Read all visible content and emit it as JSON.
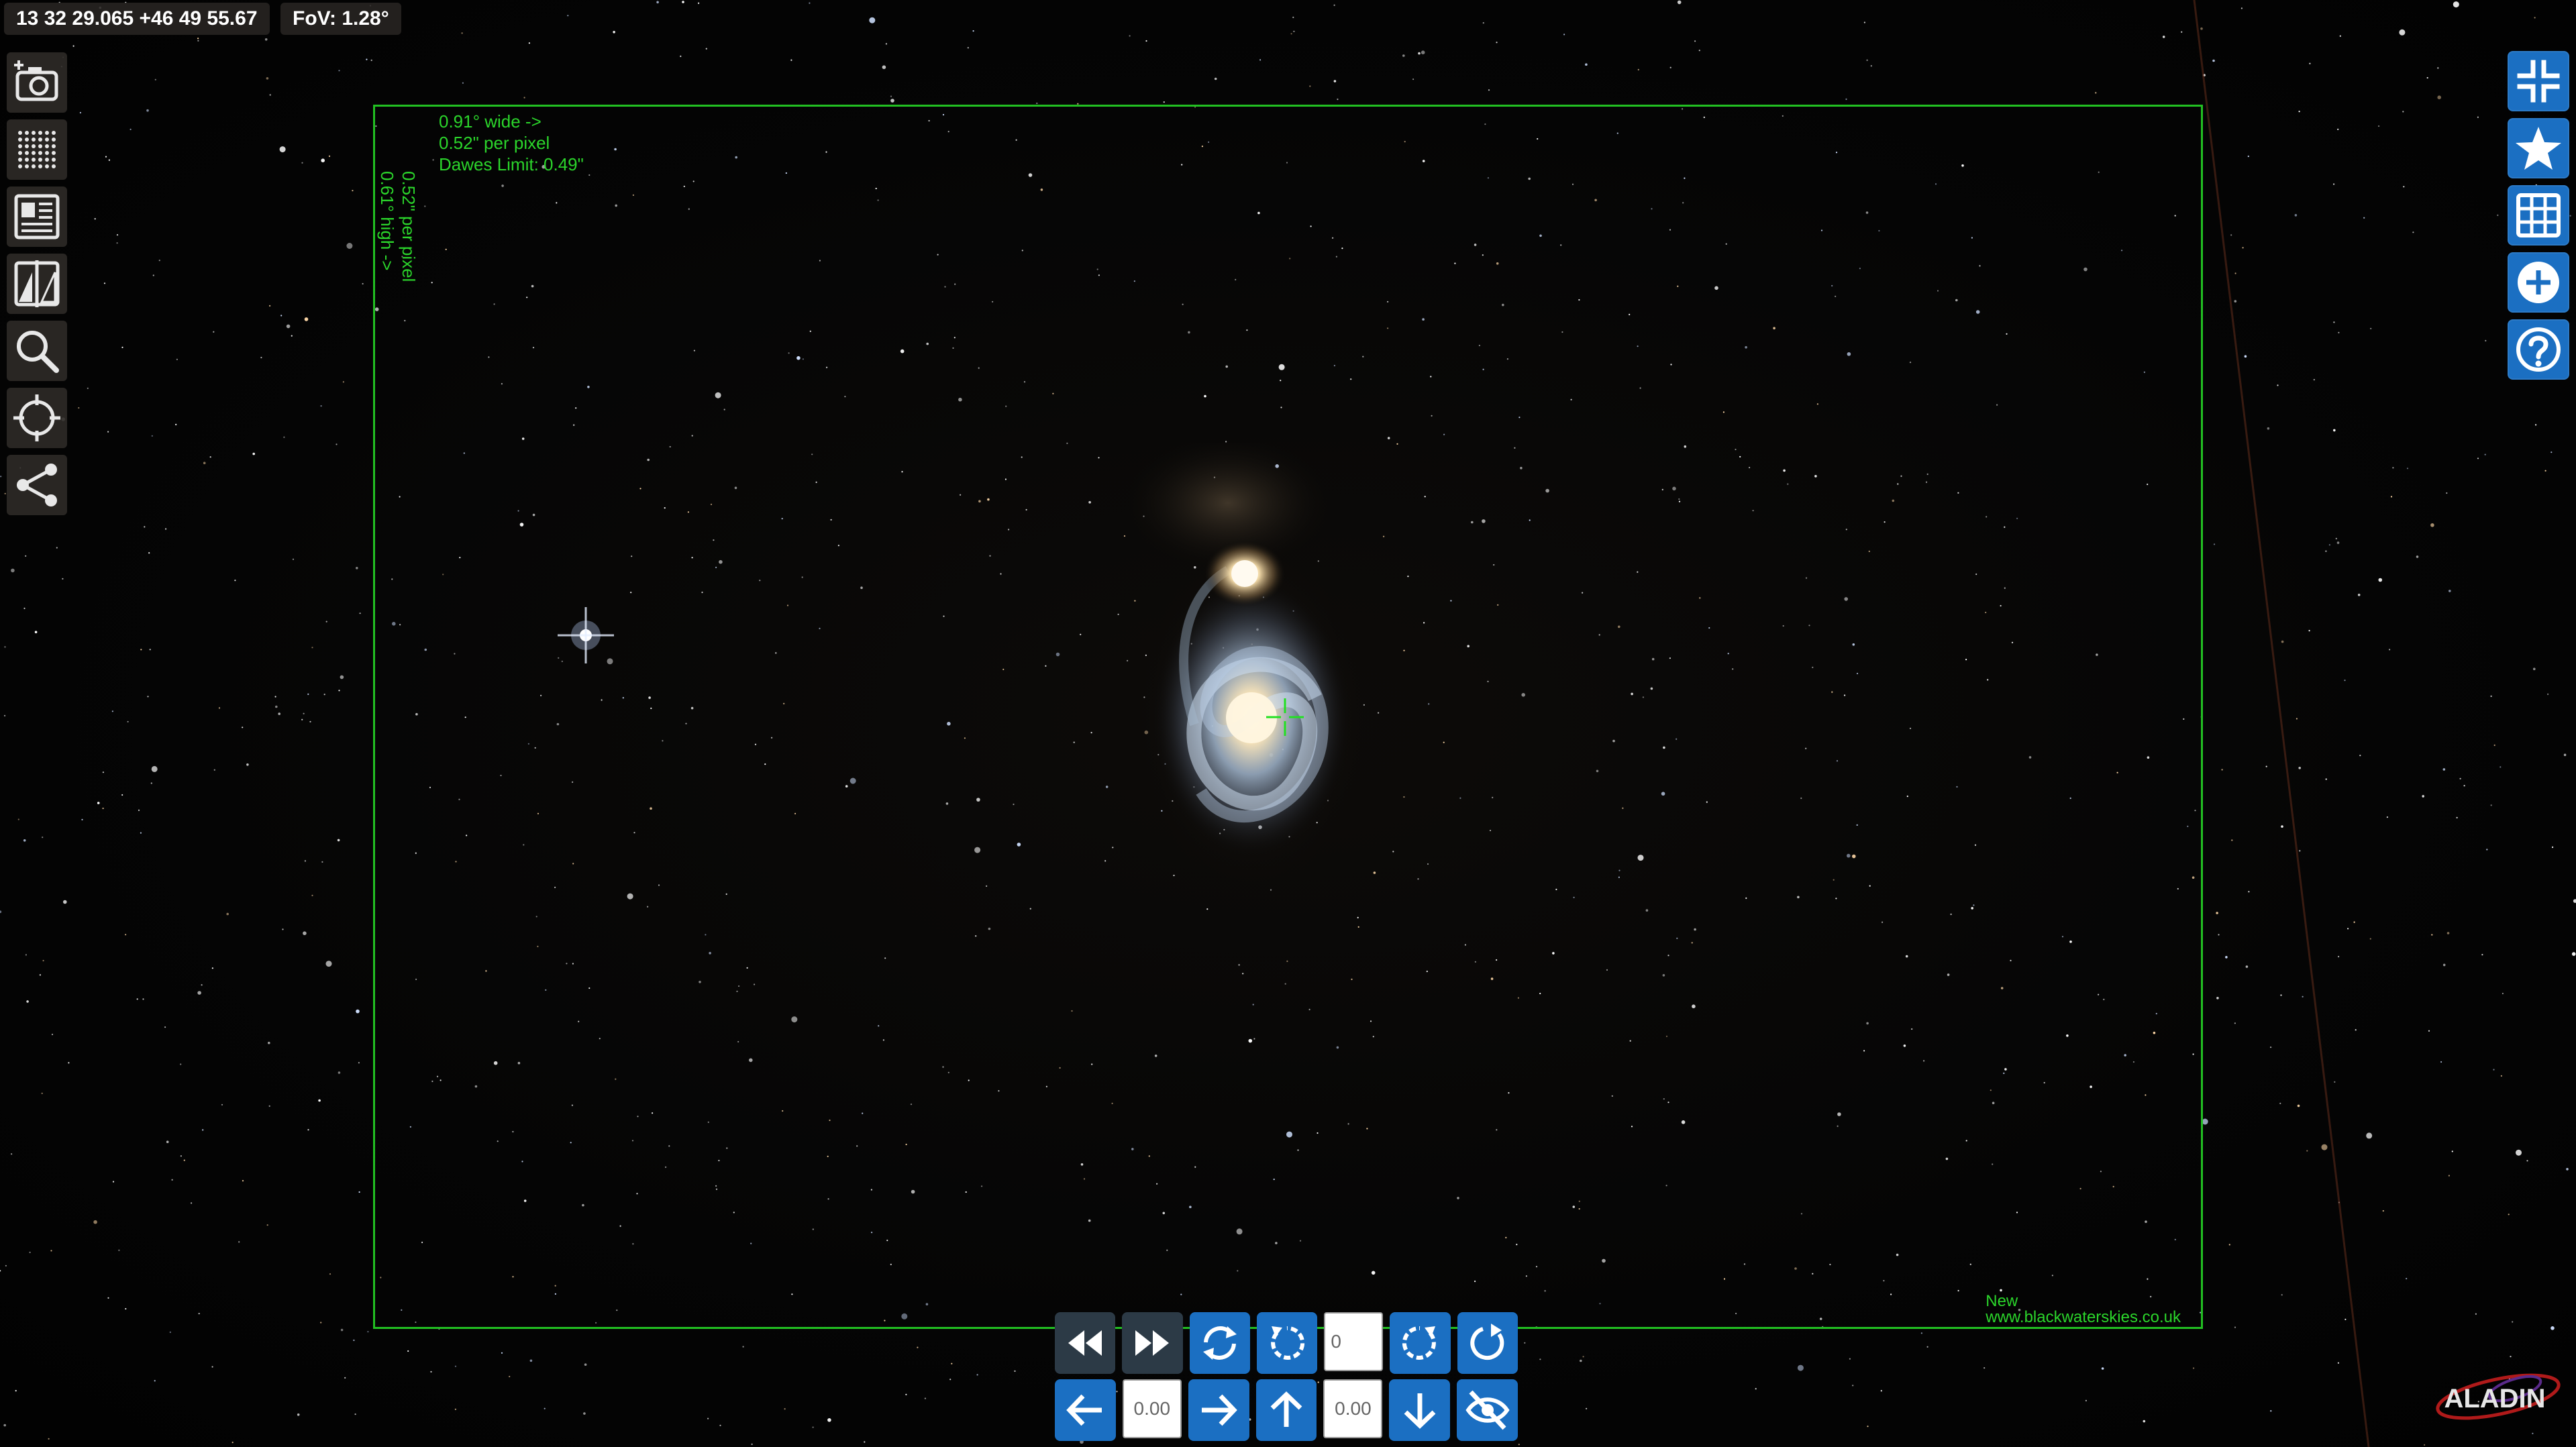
{
  "status": {
    "coordinates": "13 32 29.065 +46 49 55.67",
    "fov": "FoV: 1.28°"
  },
  "left_toolbar": [
    {
      "name": "snapshot-button",
      "icon": "camera-icon"
    },
    {
      "name": "layers-button",
      "icon": "dots-grid-icon"
    },
    {
      "name": "catalog-button",
      "icon": "panel-icon"
    },
    {
      "name": "compare-button",
      "icon": "split-view-icon"
    },
    {
      "name": "search-button",
      "icon": "search-icon"
    },
    {
      "name": "target-button",
      "icon": "target-icon"
    },
    {
      "name": "share-button",
      "icon": "share-icon"
    }
  ],
  "right_toolbar": [
    {
      "name": "collapse-button",
      "icon": "collapse-arrows-icon"
    },
    {
      "name": "favorites-button",
      "icon": "star-icon"
    },
    {
      "name": "grid-button",
      "icon": "grid-icon"
    },
    {
      "name": "add-button",
      "icon": "plus-circle-icon"
    },
    {
      "name": "help-button",
      "icon": "question-circle-icon"
    }
  ],
  "survey_frame": {
    "width_text": "0.91° wide ->",
    "pixel_text": "0.52\" per pixel",
    "dawes_text": "Dawes Limit: 0.49\"",
    "side_pixel_text": "0.52\" per pixel",
    "side_height_text": "0.61° high ->",
    "credit_line1": "New",
    "credit_line2": "www.blackwaterskies.co.uk",
    "color": "#22c022"
  },
  "controls": {
    "rotation_value": "0",
    "x_offset_value": "0.00",
    "y_offset_value": "0.00",
    "accent_color": "#1b6fc2"
  },
  "logo": {
    "text": "ALADIN"
  }
}
